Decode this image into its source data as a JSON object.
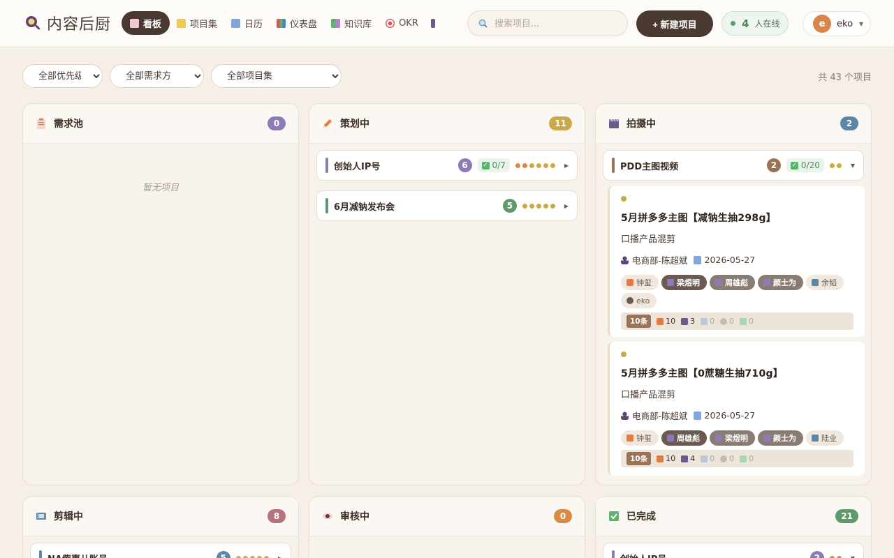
{
  "app": {
    "title": "内容后厨"
  },
  "nav": {
    "items": [
      {
        "label": "看板",
        "icon": "board-icon",
        "active": true
      },
      {
        "label": "项目集",
        "icon": "folder-icon"
      },
      {
        "label": "日历",
        "icon": "calendar-icon"
      },
      {
        "label": "仪表盘",
        "icon": "chart-icon"
      },
      {
        "label": "知识库",
        "icon": "books-icon"
      },
      {
        "label": "OKR",
        "icon": "target-icon"
      }
    ]
  },
  "search": {
    "placeholder": "搜索项目..."
  },
  "toolbar": {
    "new_label": "+ 新建项目"
  },
  "online": {
    "count": "4",
    "label": "人在线"
  },
  "user": {
    "initial": "e",
    "name": "eko"
  },
  "filters": {
    "priority": "全部优先级",
    "requester": "全部需求方",
    "project_set": "全部项目集",
    "total": "共 43 个项目"
  },
  "columns": {
    "pool": {
      "title": "需求池",
      "count": "0",
      "empty": "暂无项目"
    },
    "planning": {
      "title": "策划中",
      "count": "11",
      "groups": [
        {
          "name": "创始人IP号",
          "count": "6",
          "check": "0/7"
        },
        {
          "name": "6月减钠发布会",
          "count": "5"
        }
      ]
    },
    "shooting": {
      "title": "拍摄中",
      "count": "2",
      "group": {
        "name": "PDD主图视频",
        "count": "2",
        "check": "0/20"
      },
      "cards": [
        {
          "title": "5月拼多多主图【减钠生抽298g】",
          "subtitle": "口播产品混剪",
          "requester": "电商部-陈超斌",
          "date": "2026-05-27",
          "tags": [
            "钟玺",
            "梁煜明",
            "周雄彪",
            "颜士为",
            "余韬",
            "eko"
          ],
          "stats": {
            "total": "10条",
            "plan": "10",
            "shoot": "3",
            "edit": "0",
            "review": "0",
            "done": "0"
          }
        },
        {
          "title": "5月拼多多主图【0蔗糖生抽710g】",
          "subtitle": "口播产品混剪",
          "requester": "电商部-陈超斌",
          "date": "2026-05-27",
          "tags": [
            "钟玺",
            "周雄彪",
            "梁煜明",
            "颜士为",
            "陆业"
          ],
          "stats": {
            "total": "10条",
            "plan": "10",
            "shoot": "4",
            "edit": "0",
            "review": "0",
            "done": "0"
          }
        }
      ]
    },
    "editing": {
      "title": "剪辑中",
      "count": "8",
      "group": {
        "name": "NA紫惠儿账号",
        "count": "5"
      }
    },
    "review": {
      "title": "审核中",
      "count": "0"
    },
    "done": {
      "title": "已完成",
      "count": "21",
      "group": {
        "name": "创始人IP号",
        "count": "2"
      }
    }
  },
  "colors": {
    "brand_dark": "#4a3931",
    "pool": "#8e7ab5",
    "planning": "#c9a94a",
    "shooting": "#5c86a6",
    "editing": "#b5727f",
    "review": "#d98b45",
    "done": "#5e9a6c"
  }
}
